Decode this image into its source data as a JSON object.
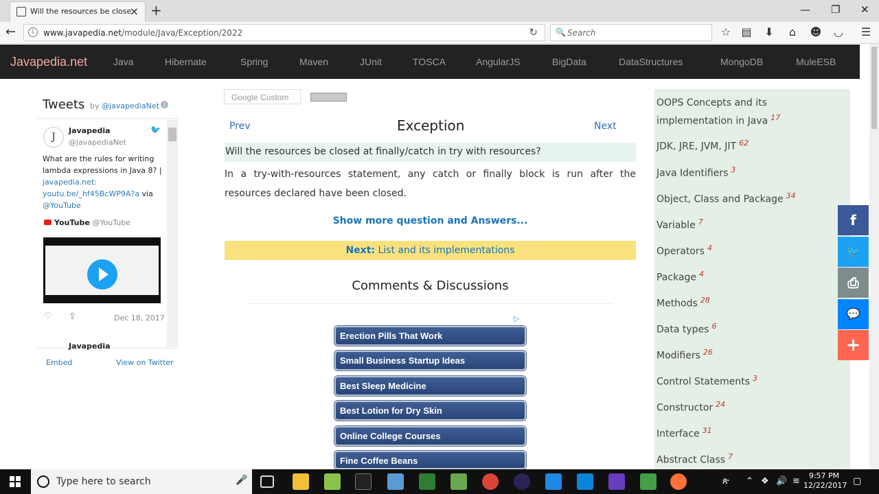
{
  "browser": {
    "tab_title": "Will the resources be close...",
    "url_host": "www.javapedia.net",
    "url_path": "/module/Java/Exception/2022",
    "search_placeholder": "Search"
  },
  "site": {
    "logo": "Javapedia.net",
    "menu": [
      "Java",
      "Hibernate",
      "Spring",
      "Maven",
      "JUnit",
      "TOSCA",
      "AngularJS",
      "BigData",
      "DataStructures",
      "MongoDB",
      "MuleESB"
    ]
  },
  "twitter": {
    "heading": "Tweets",
    "by": "by",
    "by_handle": "@javapediaNet",
    "info_icon": "i",
    "avatar_glyph": "J",
    "author_name": "Javapedia",
    "author_handle": "@javapediaNet",
    "tweet_line1": "What are the rules for writing lambda expressions in Java 8? | ",
    "tweet_link1": "javapedia.net:",
    "tweet_link2": "youtu.be/_hf45BcWP9A?a",
    "tweet_via": " via",
    "tweet_link3": "@YouTube",
    "yt_name": "YouTube",
    "yt_handle": "@YouTube",
    "date": "Dec 18, 2017",
    "next_author": "Javapedia",
    "embed": "Embed",
    "view_on": "View on Twitter"
  },
  "main": {
    "google_search": "Google Custom",
    "prev": "Prev",
    "next": "Next",
    "title": "Exception",
    "question": "Will the resources be closed at finally/catch in try with resources?",
    "answer": "In a try-with-resources statement, any catch or finally block is run after the resources declared have been closed.",
    "show_more": "Show more question and Answers...",
    "next_label": "Next:",
    "next_topic": "List and its implementations",
    "comments": "Comments & Discussions",
    "ad_choice_icon": "adchoices-icon",
    "ads": [
      "Erection Pills That Work",
      "Small Business Startup Ideas",
      "Best Sleep Medicine",
      "Best Lotion for Dry Skin",
      "Online College Courses",
      "Fine Coffee Beans"
    ]
  },
  "sidebar": {
    "items": [
      {
        "label": "OOPS Concepts and its implementation in Java",
        "count": "17"
      },
      {
        "label": "JDK, JRE, JVM, JIT",
        "count": "62"
      },
      {
        "label": "Java Identifiers",
        "count": "3"
      },
      {
        "label": "Object, Class and Package",
        "count": "34"
      },
      {
        "label": "Variable",
        "count": "7"
      },
      {
        "label": "Operators",
        "count": "4"
      },
      {
        "label": "Package",
        "count": "4"
      },
      {
        "label": "Methods",
        "count": "28"
      },
      {
        "label": "Data types",
        "count": "6"
      },
      {
        "label": "Modifiers",
        "count": "26"
      },
      {
        "label": "Control Statements",
        "count": "3"
      },
      {
        "label": "Constructor",
        "count": "24"
      },
      {
        "label": "Interface",
        "count": "31"
      },
      {
        "label": "Abstract Class",
        "count": "7"
      }
    ]
  },
  "share": [
    {
      "icon": "facebook-icon",
      "glyph": "f",
      "color": "#3b5998"
    },
    {
      "icon": "twitter-icon",
      "glyph": "🐦",
      "color": "#1da1f2"
    },
    {
      "icon": "print-icon",
      "glyph": "⎙",
      "color": "#7f8c8d"
    },
    {
      "icon": "messenger-icon",
      "glyph": "💬",
      "color": "#0084ff"
    },
    {
      "icon": "more-icon",
      "glyph": "+",
      "color": "#ff6550"
    }
  ],
  "taskbar": {
    "search_placeholder": "Type here to search",
    "time": "9:57 PM",
    "date": "12/22/2017"
  }
}
